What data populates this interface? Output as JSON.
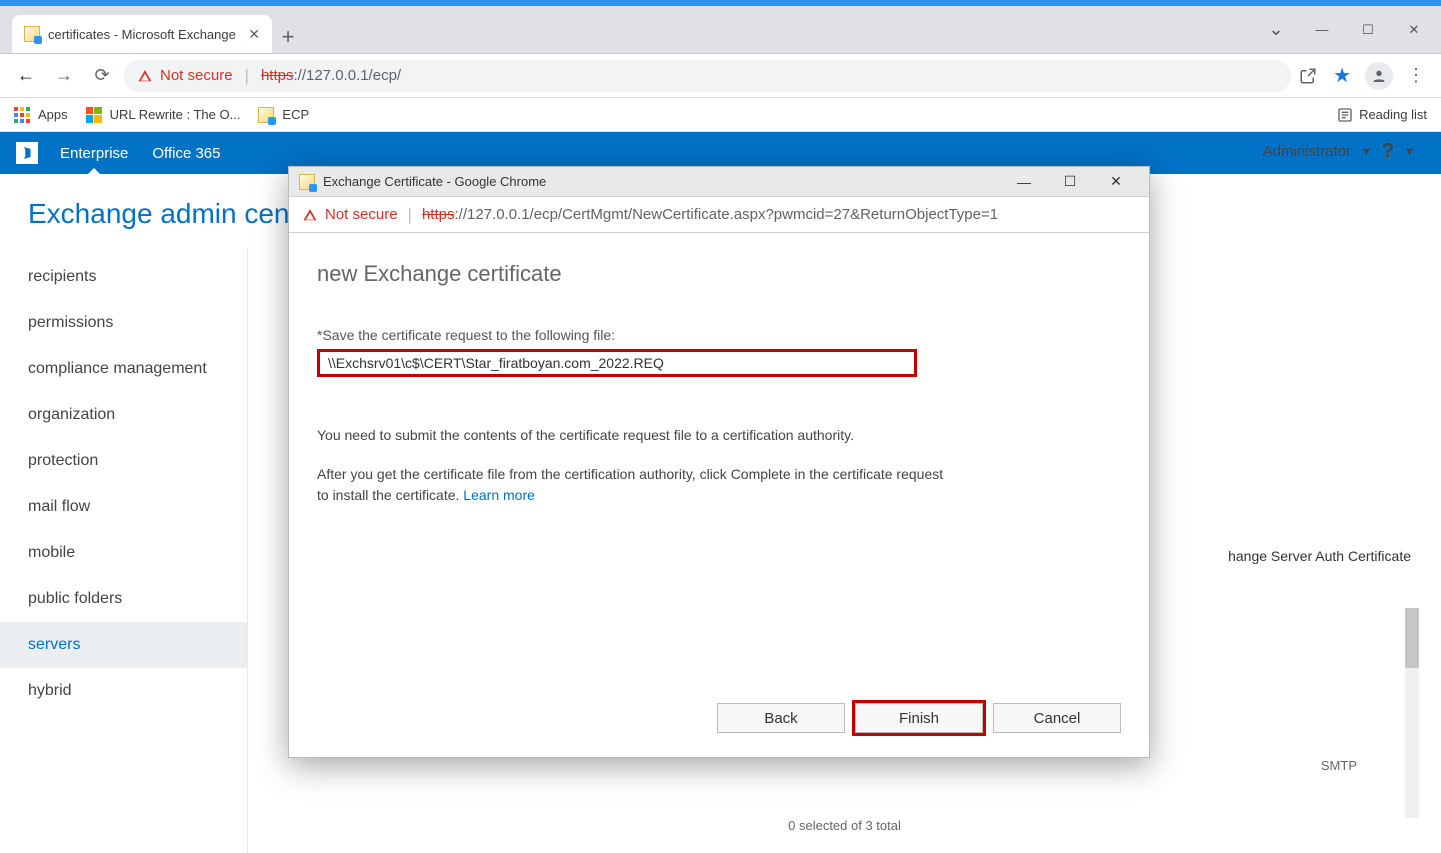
{
  "browser": {
    "tab_title": "certificates - Microsoft Exchange",
    "security_label": "Not secure",
    "url_protocol": "https",
    "url_rest": "://127.0.0.1/ecp/",
    "bookmarks": {
      "apps": "Apps",
      "url_rewrite": "URL Rewrite : The O...",
      "ecp": "ECP",
      "reading_list": "Reading list"
    }
  },
  "eac": {
    "header": {
      "enterprise": "Enterprise",
      "office365": "Office 365"
    },
    "title": "Exchange admin cente",
    "nav": {
      "recipients": "recipients",
      "permissions": "permissions",
      "compliance": "compliance management",
      "organization": "organization",
      "protection": "protection",
      "mailflow": "mail flow",
      "mobile": "mobile",
      "publicfolders": "public folders",
      "servers": "servers",
      "hybrid": "hybrid"
    },
    "user": {
      "name": "Administrator"
    },
    "content": {
      "cert_peek": "hange Server Auth Certificate",
      "smtp_peek": "SMTP",
      "footer": "0 selected of 3 total"
    }
  },
  "popup": {
    "window_title": "Exchange Certificate - Google Chrome",
    "security_label": "Not secure",
    "url_protocol": "https",
    "url_rest": "://127.0.0.1/ecp/CertMgmt/NewCertificate.aspx?pwmcid=27&ReturnObjectType=1",
    "heading": "new Exchange certificate",
    "field_label": "*Save the certificate request to the following file:",
    "field_value": "\\\\Exchsrv01\\c$\\CERT\\Star_firatboyan.com_2022.REQ",
    "help1": "You need to submit the contents of the certificate request file to a certification authority.",
    "help2a": "After you get the certificate file from the certification authority, click Complete in the certificate request to install the certificate. ",
    "help2_link": "Learn more",
    "buttons": {
      "back": "Back",
      "finish": "Finish",
      "cancel": "Cancel"
    }
  }
}
